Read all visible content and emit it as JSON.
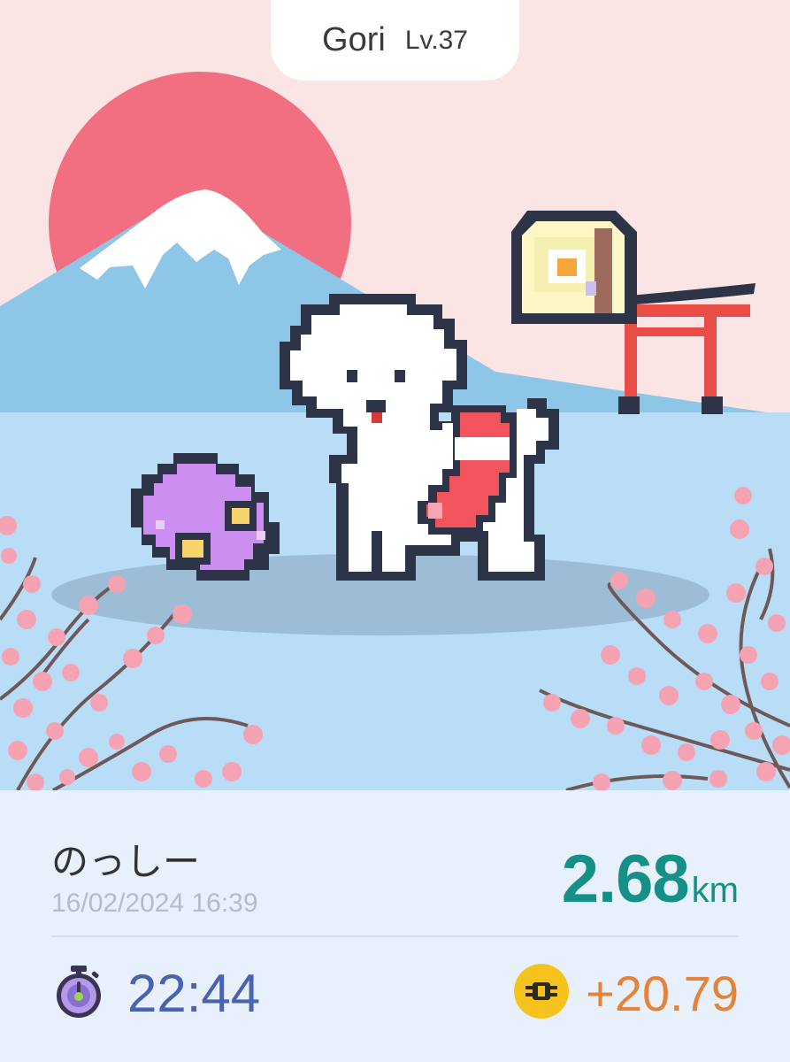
{
  "pet": {
    "name": "Gori",
    "level": "Lv.37"
  },
  "walk": {
    "title": "のっしー",
    "date": "16/02/2024 16:39",
    "distance": "2.68",
    "distance_unit": "km",
    "duration": "22:44",
    "earned": "+20.79"
  },
  "icons": {
    "duration": "stopwatch-icon",
    "earned": "token-coin-icon"
  },
  "colors": {
    "sky": "#fbe4e4",
    "sun": "#f26f82",
    "mountain": "#8ec6e8",
    "ground": "#b9dcf7",
    "panel": "#e8f0fc",
    "distance": "#149087",
    "duration": "#4a63b1",
    "earned": "#e5833b",
    "torii": "#ea4c46"
  }
}
